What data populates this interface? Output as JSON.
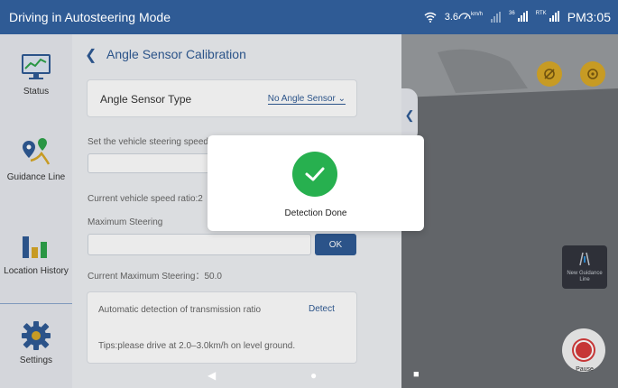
{
  "statusbar": {
    "title": "Driving in Autosteering Mode",
    "speed": "3.6",
    "speed_unit": "km/h",
    "sat_count": "36",
    "rtk_label": "RTK",
    "time": "PM3:05",
    "colors": {
      "bar": "#2f5b95",
      "text": "#ffffff"
    }
  },
  "sidebar": {
    "items": [
      {
        "label": "Status",
        "icon": "monitor-chart-icon"
      },
      {
        "label": "Guidance Line",
        "icon": "route-pin-icon"
      },
      {
        "label": "Location History",
        "icon": "bar-chart-icon"
      },
      {
        "label": "Settings",
        "icon": "gear-icon"
      }
    ]
  },
  "panel": {
    "title": "Angle Sensor Calibration",
    "sensor_type_label": "Angle Sensor Type",
    "sensor_type_value": "No Angle Sensor",
    "speed_instruction": "Set the vehicle steering speed",
    "speed_ratio_label": "Current vehicle speed ratio:",
    "speed_ratio_value": "2",
    "max_steering_label": "Maximum Steering",
    "ok_label": "OK",
    "current_max_label": "Current Maximum Steering：",
    "current_max_value": "50.0",
    "auto_detect_label": "Automatic detection of transmission ratio",
    "detect_label": "Detect",
    "tips": "Tips:please drive at 2.0–3.0km/h on level ground."
  },
  "camera": {
    "tile_label": "New Guidance Line",
    "pause_label": "Pause"
  },
  "dialog": {
    "message": "Detection Done",
    "color": "#27b04f"
  }
}
